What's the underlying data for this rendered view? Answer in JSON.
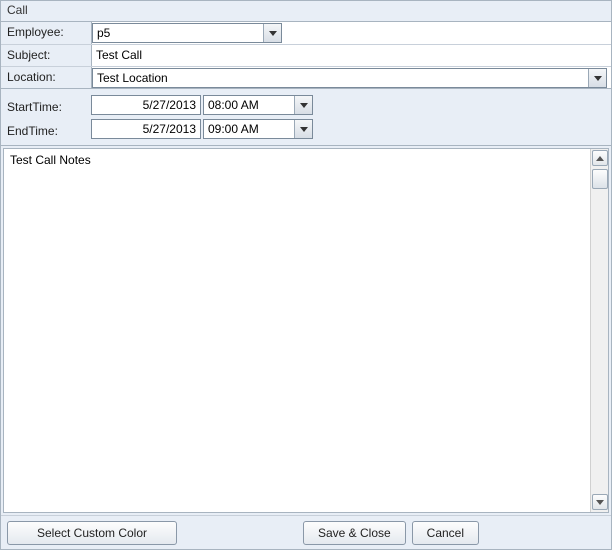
{
  "window": {
    "title": "Call"
  },
  "fields": {
    "employee_label": "Employee:",
    "employee_value": "p5",
    "subject_label": "Subject:",
    "subject_value": "Test Call",
    "location_label": "Location:",
    "location_value": "Test Location"
  },
  "times": {
    "start_label": "StartTime:",
    "start_date": "5/27/2013",
    "start_time": "08:00 AM",
    "end_label": "EndTime:",
    "end_date": "5/27/2013",
    "end_time": "09:00 AM"
  },
  "notes": {
    "value": "Test Call Notes"
  },
  "buttons": {
    "color": "Select Custom Color",
    "save": "Save & Close",
    "cancel": "Cancel"
  }
}
